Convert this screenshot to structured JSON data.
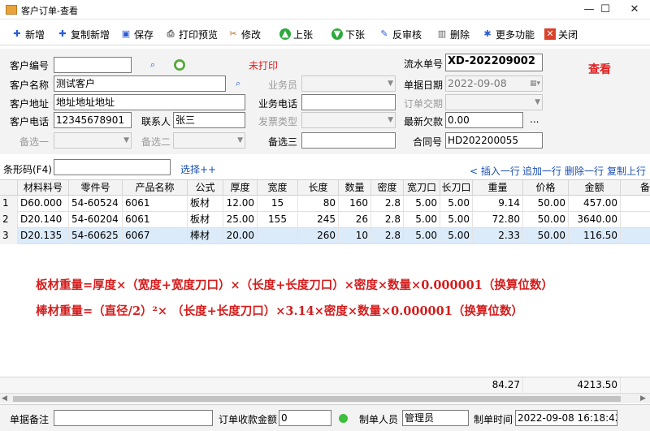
{
  "window": {
    "title": "客户订单-查看",
    "minimize": "—",
    "maximize": "☐",
    "close": "✕"
  },
  "toolbar": [
    {
      "label": "新增",
      "icon": "plus-icon"
    },
    {
      "label": "复制新增",
      "icon": "copy-plus-icon"
    },
    {
      "label": "保存",
      "icon": "save-icon"
    },
    {
      "label": "打印预览",
      "icon": "printer-icon"
    },
    {
      "label": "修改",
      "icon": "edit-icon"
    },
    {
      "label": "上张",
      "icon": "arrow-up-icon"
    },
    {
      "label": "下张",
      "icon": "arrow-down-icon"
    },
    {
      "label": "反审核",
      "icon": "undo-icon"
    },
    {
      "label": "删除",
      "icon": "trash-icon"
    },
    {
      "label": "更多功能",
      "icon": "gear-icon"
    },
    {
      "label": "关闭",
      "icon": "close-icon"
    }
  ],
  "form": {
    "customer_no": {
      "label": "客户编号",
      "value": ""
    },
    "print_status": "未打印",
    "serial": {
      "label": "流水单号",
      "value": "XD-202209002"
    },
    "view_mode": "查看",
    "customer_name": {
      "label": "客户名称",
      "value": "测试客户"
    },
    "salesman": {
      "label": "业务员",
      "value": ""
    },
    "doc_date": {
      "label": "单据日期",
      "value": "2022-09-08"
    },
    "customer_address": {
      "label": "客户地址",
      "value": "地址地址地址"
    },
    "biz_phone": {
      "label": "业务电话",
      "value": ""
    },
    "delivery_date": {
      "label": "订单交期",
      "value": ""
    },
    "customer_phone": {
      "label": "客户电话",
      "value": "12345678901"
    },
    "contact": {
      "label": "联系人",
      "value": "张三"
    },
    "invoice_type": {
      "label": "发票类型",
      "value": ""
    },
    "latest_debt": {
      "label": "最新欠款",
      "value": "0.00",
      "button": "..."
    },
    "spare1": {
      "label": "备选一",
      "value": ""
    },
    "spare2": {
      "label": "备选二",
      "value": ""
    },
    "spare3": {
      "label": "备选三",
      "value": ""
    },
    "contract": {
      "label": "合同号",
      "value": "HD202200055"
    }
  },
  "barcode": {
    "label": "条形码(F4)",
    "value": "",
    "select": "选择++"
  },
  "row_actions": {
    "insert": "插入一行",
    "append": "追加一行",
    "delete": "删除一行",
    "copy": "复制上行"
  },
  "table": {
    "headers": [
      "材料料号",
      "零件号",
      "产品名称",
      "公式",
      "厚度",
      "宽度",
      "长度",
      "数量",
      "密度",
      "宽刀口",
      "长刀口",
      "重量",
      "价格",
      "金额",
      "备"
    ],
    "rows": [
      {
        "num": "1",
        "cells": [
          "D60.000",
          "54-60524",
          "6061",
          "板材",
          "12.00",
          "15",
          "80",
          "160",
          "2.8",
          "5.00",
          "5.00",
          "9.14",
          "50.00",
          "457.00"
        ]
      },
      {
        "num": "2",
        "cells": [
          "D20.140",
          "54-60204",
          "6061",
          "板材",
          "25.00",
          "155",
          "245",
          "26",
          "2.8",
          "5.00",
          "5.00",
          "72.80",
          "50.00",
          "3640.00"
        ]
      },
      {
        "num": "3",
        "cells": [
          "D20.135",
          "54-60625",
          "6067",
          "棒材",
          "20.00",
          "",
          "260",
          "10",
          "2.8",
          "5.00",
          "5.00",
          "2.33",
          "50.00",
          "116.50"
        ]
      }
    ],
    "totals": {
      "weight": "84.27",
      "amount": "4213.50"
    }
  },
  "notes": {
    "plate_formula": "板材重量=厚度×（宽度+宽度刀口）×（长度+长度刀口）×密度×数量×0.000001（换算位数）",
    "bar_formula": "棒材重量=（直径/2）²× （长度+长度刀口）×3.14×密度×数量×0.000001（换算位数）"
  },
  "footer": {
    "remark": {
      "label": "单据备注",
      "value": ""
    },
    "received": {
      "label": "订单收款金额",
      "value": "0"
    },
    "creator": {
      "label": "制单人员",
      "value": "管理员"
    },
    "created_time": {
      "label": "制单时间",
      "value": "2022-09-08 16:18:42"
    }
  }
}
